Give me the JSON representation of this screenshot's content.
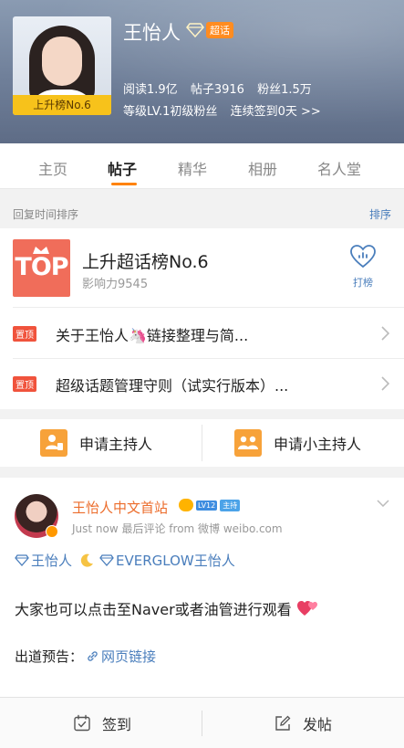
{
  "profile": {
    "name": "王怡人",
    "super_badge": "超话",
    "rank_label": "上升榜No.6",
    "stats": {
      "read": "阅读1.9亿",
      "posts": "帖子3916",
      "fans": "粉丝1.5万"
    },
    "level": "等级LV.1初级粉丝",
    "checkin": "连续签到0天 >>"
  },
  "tabs": [
    {
      "label": "主页",
      "active": false
    },
    {
      "label": "帖子",
      "active": true
    },
    {
      "label": "精华",
      "active": false
    },
    {
      "label": "相册",
      "active": false
    },
    {
      "label": "名人堂",
      "active": false
    }
  ],
  "sort": {
    "left": "回复时间排序",
    "right": "排序"
  },
  "top_card": {
    "logo": "TOP",
    "title": "上升超话榜No.6",
    "influence": "影响力9545",
    "action": "打榜"
  },
  "pinned": [
    {
      "tag": "置顶",
      "text": "关于王怡人🦄链接整理与简..."
    },
    {
      "tag": "置顶",
      "text": "超级话题管理守则（试实行版本）..."
    }
  ],
  "actions": {
    "host": "申请主持人",
    "sub_host": "申请小主持人"
  },
  "post": {
    "author": "王怡人中文首站",
    "lv_badge": "LV12",
    "host_badge": "主持",
    "meta": "Just now  最后评论   from 微博 weibo.com",
    "tag1": "王怡人",
    "tag2": "EVERGLOW王怡人",
    "body": "大家也可以点击至Naver或者油管进行观看",
    "preview_label": "出道预告：",
    "link_label": "网页链接"
  },
  "bottom": {
    "checkin": "签到",
    "post": "发帖"
  },
  "colors": {
    "accent": "#ff8200",
    "link": "#4a7ebc",
    "pin": "#f0533c"
  }
}
